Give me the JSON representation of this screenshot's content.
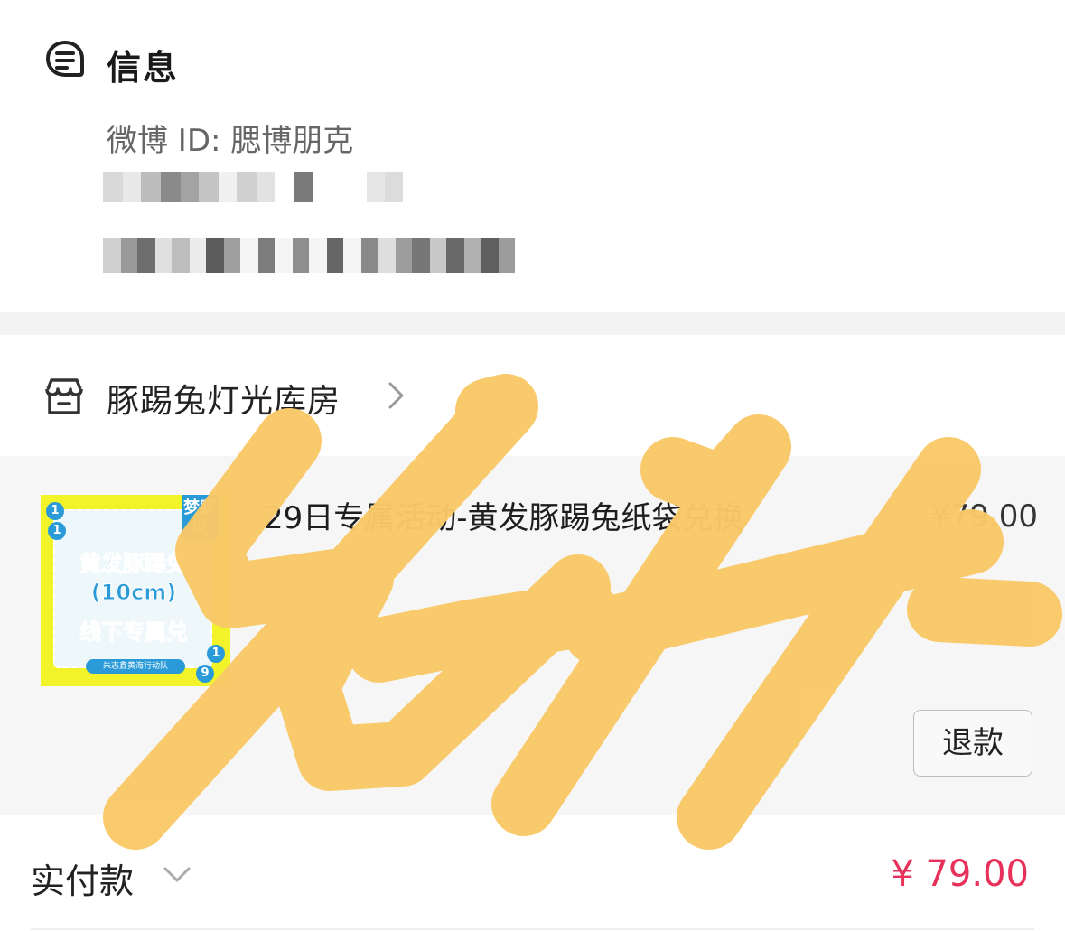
{
  "info": {
    "title": "信息",
    "weibo_id": "微博 ID: 腮博朋克",
    "icon": "message-list-icon"
  },
  "store": {
    "name": "豚踢兔灯光库房",
    "icon": "storefront-icon",
    "chevron_icon": "chevron-right-icon"
  },
  "product": {
    "title": "29日专属活动-黄发豚踢兔纸袋兑换",
    "price": "¥79.00",
    "refund_label": "退款",
    "thumbnail": {
      "line1": "黄发豚踢兔",
      "line2": "(10cm)",
      "line3": "线下专属兑",
      "corner_text": "梦寐以",
      "footer_text": "朱志鑫黄海行动队",
      "dots": [
        "1",
        "1",
        "1",
        "9"
      ],
      "bg_color": "#f3f32a",
      "accent_color": "#2a9bd8"
    }
  },
  "payment": {
    "label": "实付款",
    "chevron_icon": "chevron-down-icon",
    "amount": "¥ 79.00",
    "amount_color": "#e8315a"
  },
  "overlay": {
    "scribble_color": "#f9c968"
  }
}
